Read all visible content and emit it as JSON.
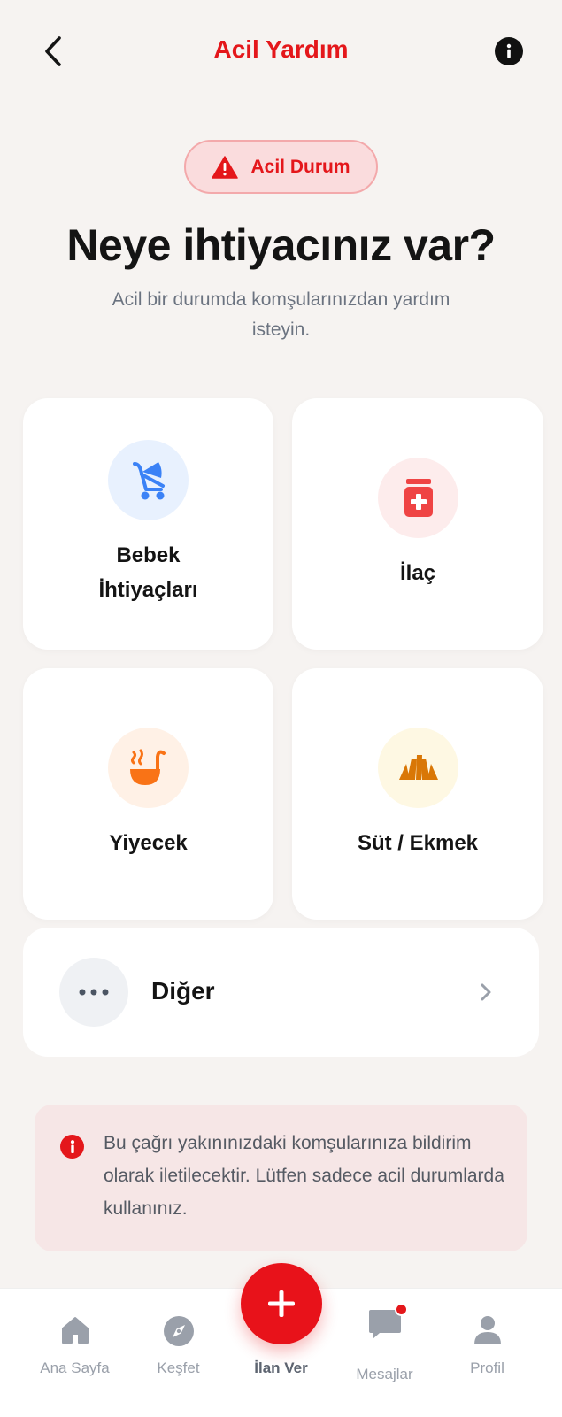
{
  "header": {
    "title": "Acil Yardım"
  },
  "badge": {
    "label": "Acil Durum"
  },
  "hero": {
    "title": "Neye ihtiyacınız var?",
    "subtitle": "Acil bir durumda komşularınızdan yardım isteyin."
  },
  "categories": [
    {
      "label_line1": "Bebek",
      "label_line2": "İhtiyaçları",
      "icon": "baby-stroller-icon",
      "color": "#3b82f6",
      "bg": "#e8f1fe"
    },
    {
      "label": "İlaç",
      "icon": "medicine-icon",
      "color": "#ef4444",
      "bg": "#fdecec"
    },
    {
      "label": "Yiyecek",
      "icon": "soup-ladle-icon",
      "color": "#f97316",
      "bg": "#fff1e6"
    },
    {
      "label": "Süt / Ekmek",
      "icon": "croissant-icon",
      "color": "#d97706",
      "bg": "#fef8e3"
    }
  ],
  "other": {
    "label": "Diğer",
    "icon": "more-dots-icon"
  },
  "notice": {
    "icon": "info-icon",
    "text": "Bu çağrı yakınınızdaki komşularınıza bildirim olarak iletilecektir. Lütfen sadece acil durumlarda kullanınız."
  },
  "tabs": [
    {
      "label": "Ana Sayfa",
      "icon": "home-icon"
    },
    {
      "label": "Keşfet",
      "icon": "compass-icon"
    },
    {
      "label": "İlan Ver",
      "icon": "plus-icon",
      "active": true
    },
    {
      "label": "Mesajlar",
      "icon": "chat-icon",
      "has_notification": true
    },
    {
      "label": "Profil",
      "icon": "user-icon"
    }
  ],
  "colors": {
    "accent": "#e4171b",
    "background": "#f6f3f1"
  }
}
